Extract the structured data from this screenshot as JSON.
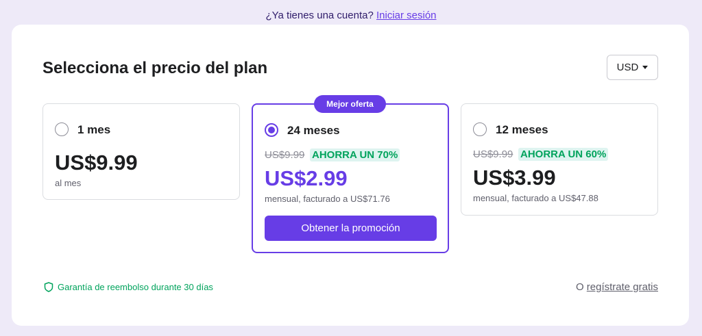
{
  "header": {
    "question": "¿Ya tienes una cuenta?",
    "login_link": "Iniciar sesión"
  },
  "main": {
    "title": "Selecciona el precio del plan",
    "currency": "USD"
  },
  "plans": [
    {
      "name": "1 mes",
      "price": "US$9.99",
      "billing": "al mes",
      "selected": false
    },
    {
      "name": "24 meses",
      "badge": "Mejor oferta",
      "old_price": "US$9.99",
      "savings": "AHORRA UN 70%",
      "price": "US$2.99",
      "billing": "mensual, facturado a US$71.76",
      "cta": "Obtener la promoción",
      "selected": true
    },
    {
      "name": "12 meses",
      "old_price": "US$9.99",
      "savings": "AHORRA UN 60%",
      "price": "US$3.99",
      "billing": "mensual, facturado a US$47.88",
      "selected": false
    }
  ],
  "footer": {
    "guarantee": "Garantía de reembolso durante 30 días",
    "register_prefix": "O",
    "register_link": "regístrate gratis"
  },
  "colors": {
    "accent": "#673de6",
    "savings_green": "#00a35c",
    "background": "#eeeaf8"
  }
}
